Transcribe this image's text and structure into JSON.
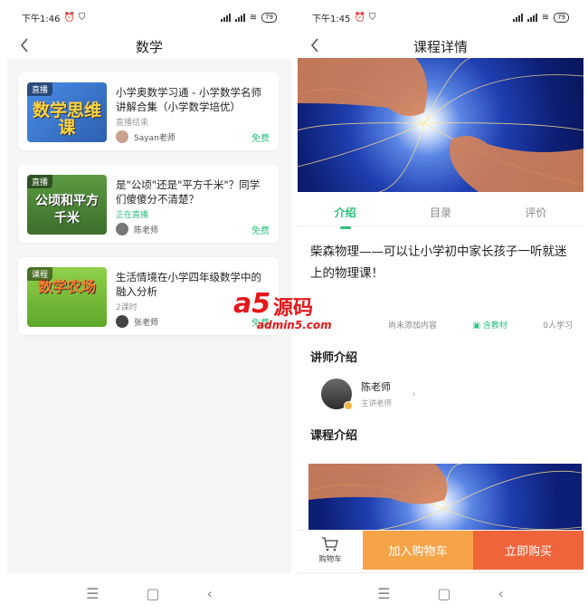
{
  "left": {
    "status": {
      "time": "下午1:46",
      "battery": "79"
    },
    "nav_title": "数学",
    "courses": [
      {
        "tag": "直播",
        "thumb_text": "数学思维课",
        "title": "小学奥数学习通 - 小学数学名师讲解合集（小学数学培优）",
        "status": "直播结束",
        "teacher": "Sayan老师",
        "price": "免费",
        "thumb_color": "#3f7fd9"
      },
      {
        "tag": "直播",
        "thumb_text": "公顷和平方千米",
        "title": "是\"公顷\"还是\"平方千米\"？同学们傻傻分不清楚？",
        "status": "正在直播",
        "teacher": "陈老师",
        "price": "免费",
        "thumb_color": "#4f8a3a"
      },
      {
        "tag": "课程",
        "thumb_text": "数学农场",
        "title": "生活情境在小学四年级数学中的融入分析",
        "status": "2课时",
        "teacher": "张老师",
        "price": "免费",
        "thumb_color": "#7cbf3c"
      }
    ]
  },
  "right": {
    "status": {
      "time": "下午1:45",
      "battery": "79"
    },
    "nav_title": "课程详情",
    "tabs": [
      "介绍",
      "目录",
      "评价"
    ],
    "course_title": "柴森物理——可以让小学初中家长孩子一听就迷上的物理课！",
    "meta": {
      "content": "尚未添加内容",
      "material": "含教材",
      "learners": "0人学习"
    },
    "teacher_section": "讲师介绍",
    "teacher": {
      "name": "陈老师",
      "role": "主讲老师"
    },
    "intro_section": "课程介绍",
    "actions": {
      "cart": "购物车",
      "add_cart": "加入购物车",
      "buy": "立即购买"
    }
  },
  "watermark": {
    "brand": "a5",
    "cn": "源码",
    "url": "admin5.com"
  },
  "colors": {
    "accent": "#2bbf7a",
    "orange": "#f5a447",
    "red": "#f0643c"
  }
}
